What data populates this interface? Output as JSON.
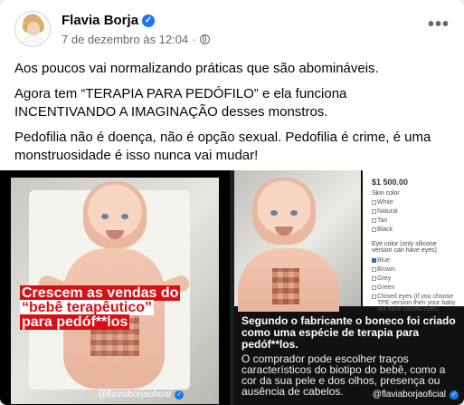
{
  "post": {
    "author": "Flavia Borja",
    "date": "7 de dezembro às 12:04",
    "more_label": "•••",
    "paragraphs": [
      "Aos poucos vai normalizando práticas que são abomináveis.",
      "Agora tem “TERAPIA PARA PEDÓFILO” e ela funciona INCENTIVANDO A IMAGINAÇÃO  desses monstros.",
      "Pedofilia não é doença, não é opção sexual. Pedofilia é crime, é uma monstruosidade é isso nunca vai mudar!"
    ]
  },
  "left_image": {
    "caption_1": "Crescem as vendas do",
    "caption_2": "“bebê terapêutico”",
    "caption_3": "para pedóf**los",
    "handle": "@flaviaborjaoficial"
  },
  "right_image": {
    "price": "$1 500.00",
    "skin_title": "Skin color",
    "skin_options": [
      "White",
      "Natural",
      "Tan",
      "Black"
    ],
    "eye_title": "Eye color (only silicone version can have eyes)",
    "eye_options": [
      "Blue",
      "Brown",
      "Grey",
      "Green",
      "Closed eyes (if you choose TPE version then your baby will have closed eyes)"
    ],
    "headline": "Segundo o fabricante o boneco foi criado como uma espécie de terapia para pedóf**los.",
    "subtext": "O comprador pode escolher traços característicos do biotipo do bebê, como a cor da sua pele e dos olhos, presença ou ausência de cabelos.",
    "handle": "@flaviaborjaoficial"
  },
  "colors": {
    "accent": "#1877f2",
    "caption_red": "#d90f16"
  },
  "icons": {
    "verified": "verified-badge-icon",
    "globe": "globe-icon",
    "more": "more-icon"
  }
}
